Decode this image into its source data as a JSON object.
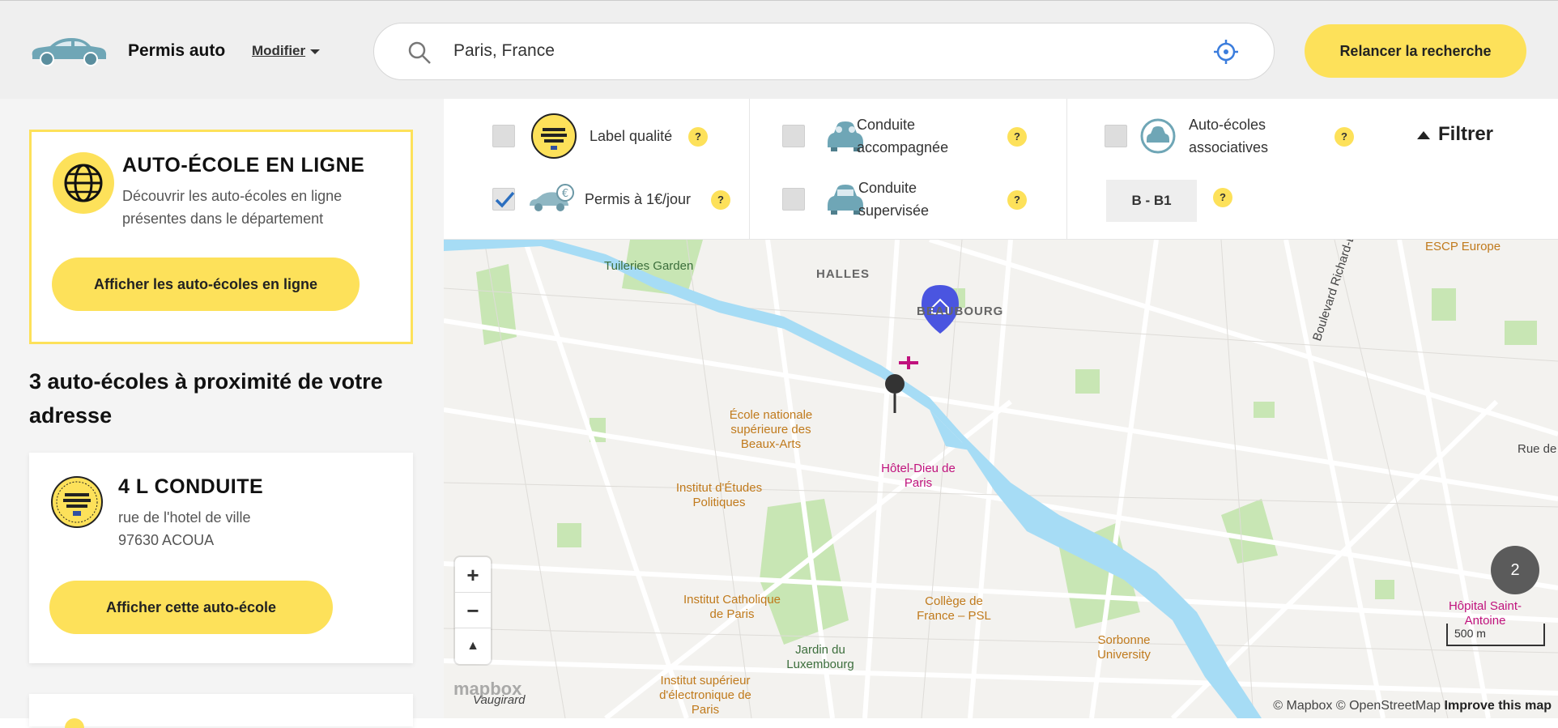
{
  "header": {
    "product": "Permis auto",
    "modifier_label": "Modifier",
    "search_value": "Paris, France",
    "relaunch_label": "Relancer la recherche"
  },
  "online": {
    "title": "AUTO-ÉCOLE EN LIGNE",
    "description": "Découvrir les auto-écoles en ligne présentes dans le département",
    "button": "Afficher les auto-écoles en ligne"
  },
  "results": {
    "heading": "3 auto-écoles à proximité de votre adresse",
    "cards": [
      {
        "name": "4 L CONDUITE",
        "street": "rue de l'hotel de ville",
        "city": "97630 ACOUA",
        "button": "Afficher cette auto-école"
      }
    ]
  },
  "filters": {
    "label_qualite": "Label qualité",
    "permis_1euro": "Permis à 1€/jour",
    "conduite_accompagnee": "Conduite accompagnée",
    "conduite_supervisee": "Conduite supervisée",
    "associatives": "Auto-écoles associatives",
    "filtrer": "Filtrer",
    "category": "B - B1",
    "help": "?",
    "checked": {
      "label_qualite": false,
      "permis_1euro": true,
      "conduite_accompagnee": false,
      "conduite_supervisee": false,
      "associatives": false
    }
  },
  "map": {
    "labels": {
      "tuileries": "Tuileries Garden",
      "halles": "HALLES",
      "beaubourg": "BEAUBOURG",
      "escp": "ESCP Europe",
      "boulevard": "Boulevard Richard-Lenoir",
      "rue": "Rue de",
      "beaux_arts": "École nationale supérieure des Beaux-Arts",
      "sciences_po": "Institut d'Études Politiques",
      "hotel_dieu": "Hôtel-Dieu de Paris",
      "catholique": "Institut Catholique de Paris",
      "college": "Collège de France – PSL",
      "luxembourg": "Jardin du Luxembourg",
      "sorbonne": "Sorbonne University",
      "saint_antoine": "Hôpital Saint-Antoine",
      "electronique": "Institut supérieur d'électronique de Paris",
      "vaugirard": "Vaugirard"
    },
    "cluster_count": "2",
    "scale": "500 m",
    "attribution": "© Mapbox © OpenStreetMap",
    "improve": "Improve this map",
    "mapbox": "mapbox",
    "zoom_in": "+",
    "zoom_out": "−",
    "compass": "▲"
  },
  "colors": {
    "accent": "#fde15a",
    "water": "#a6dcf5",
    "park": "#c8e6b4",
    "pin": "#4a55e0"
  }
}
